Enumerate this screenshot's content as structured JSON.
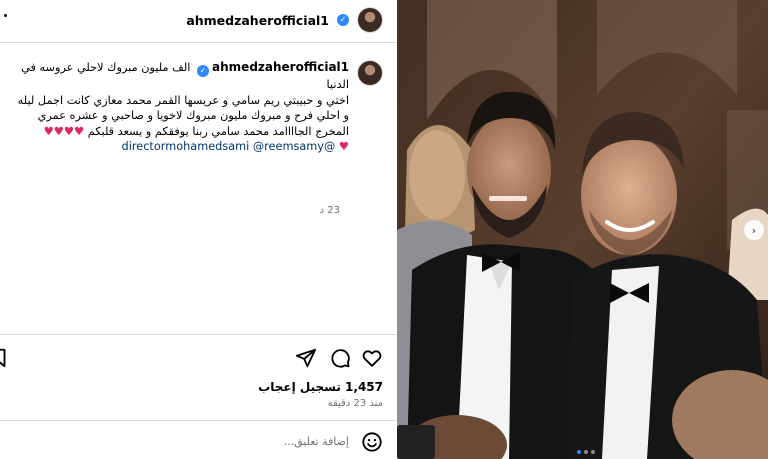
{
  "post": {
    "username": "ahmedzaherofficial1",
    "verified_mark": "✓",
    "caption_lines": [
      "الف مليون مبروك لاحلي عروسه في الدنيا",
      "اختي و حبيبتي ريم سامي و عريسها القمر محمد معازي كانت اجمل ليله",
      "و احلي فرح و مبروك مليون مبروك لاخويا و صاحبي و عشره عمري",
      "المخرج الجاااامد محمد سامي ربنا يوفقكم و يسعد قلبكم"
    ],
    "hearts": "♥♥♥♥",
    "heart_end": "♥",
    "mentions": "directormohamedsami @reemsamy@",
    "caption_time": "23 د",
    "likes": "1,457 تسجيل إعجاب",
    "since": "منذ 23 دقيقة",
    "comment_placeholder": "إضافة تعليق...",
    "icons": {
      "like": "heart-icon",
      "comment": "comment-icon",
      "share": "share-icon",
      "save": "bookmark-icon",
      "emoji": "emoji-icon"
    },
    "colors": {
      "verified": "#2f88ff",
      "hearts": "#e0245e",
      "mentions": "#00376b"
    }
  },
  "media": {
    "next_label": "›",
    "carousel_slide": 1,
    "carousel_total": 3
  }
}
